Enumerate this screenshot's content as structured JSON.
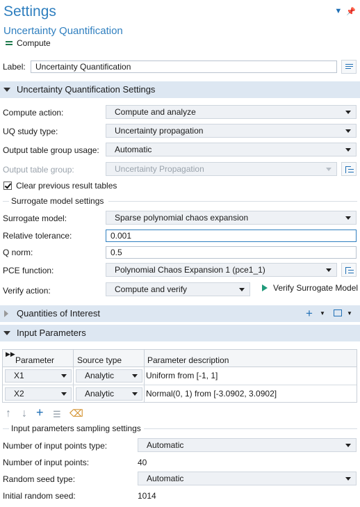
{
  "header": {
    "title": "Settings",
    "subtitle": "Uncertainty Quantification",
    "compute_label": "Compute"
  },
  "label_row": {
    "label": "Label:",
    "value": "Uncertainty Quantification"
  },
  "uq_settings": {
    "section_title": "Uncertainty Quantification Settings",
    "compute_action": {
      "label": "Compute action:",
      "value": "Compute and analyze"
    },
    "study_type": {
      "label": "UQ study type:",
      "value": "Uncertainty propagation"
    },
    "table_group_usage": {
      "label": "Output table group usage:",
      "value": "Automatic"
    },
    "table_group": {
      "label": "Output table group:",
      "value": "Uncertainty Propagation"
    },
    "clear_tables": {
      "label": "Clear previous result tables",
      "checked": true
    }
  },
  "surrogate": {
    "subheading": "Surrogate model settings",
    "model": {
      "label": "Surrogate model:",
      "value": "Sparse polynomial chaos expansion"
    },
    "rel_tol": {
      "label": "Relative tolerance:",
      "value": "0.001"
    },
    "q_norm": {
      "label": "Q norm:",
      "value": "0.5"
    },
    "pce_function": {
      "label": "PCE function:",
      "value": "Polynomial Chaos Expansion 1 (pce1_1)"
    },
    "verify_action": {
      "label": "Verify action:",
      "value": "Compute and verify"
    },
    "verify_button": "Verify Surrogate Model"
  },
  "qoi": {
    "section_title": "Quantities of Interest"
  },
  "input_params": {
    "section_title": "Input Parameters",
    "columns": [
      "Parameter",
      "Source type",
      "Parameter description"
    ],
    "rows": [
      {
        "parameter": "X1",
        "source": "Analytic",
        "description": "Uniform from [-1, 1]"
      },
      {
        "parameter": "X2",
        "source": "Analytic",
        "description": "Normal(0, 1) from [-3.0902, 3.0902]"
      }
    ]
  },
  "sampling": {
    "subheading": "Input parameters sampling settings",
    "num_points_type": {
      "label": "Number of input points type:",
      "value": "Automatic"
    },
    "num_points": {
      "label": "Number of input points:",
      "value": "40"
    },
    "seed_type": {
      "label": "Random seed type:",
      "value": "Automatic"
    },
    "initial_seed": {
      "label": "Initial random seed:",
      "value": "1014"
    }
  },
  "colors": {
    "accent": "#2f7fbf",
    "section_bg": "#dde7f2",
    "play_green": "#1f9a7a"
  }
}
